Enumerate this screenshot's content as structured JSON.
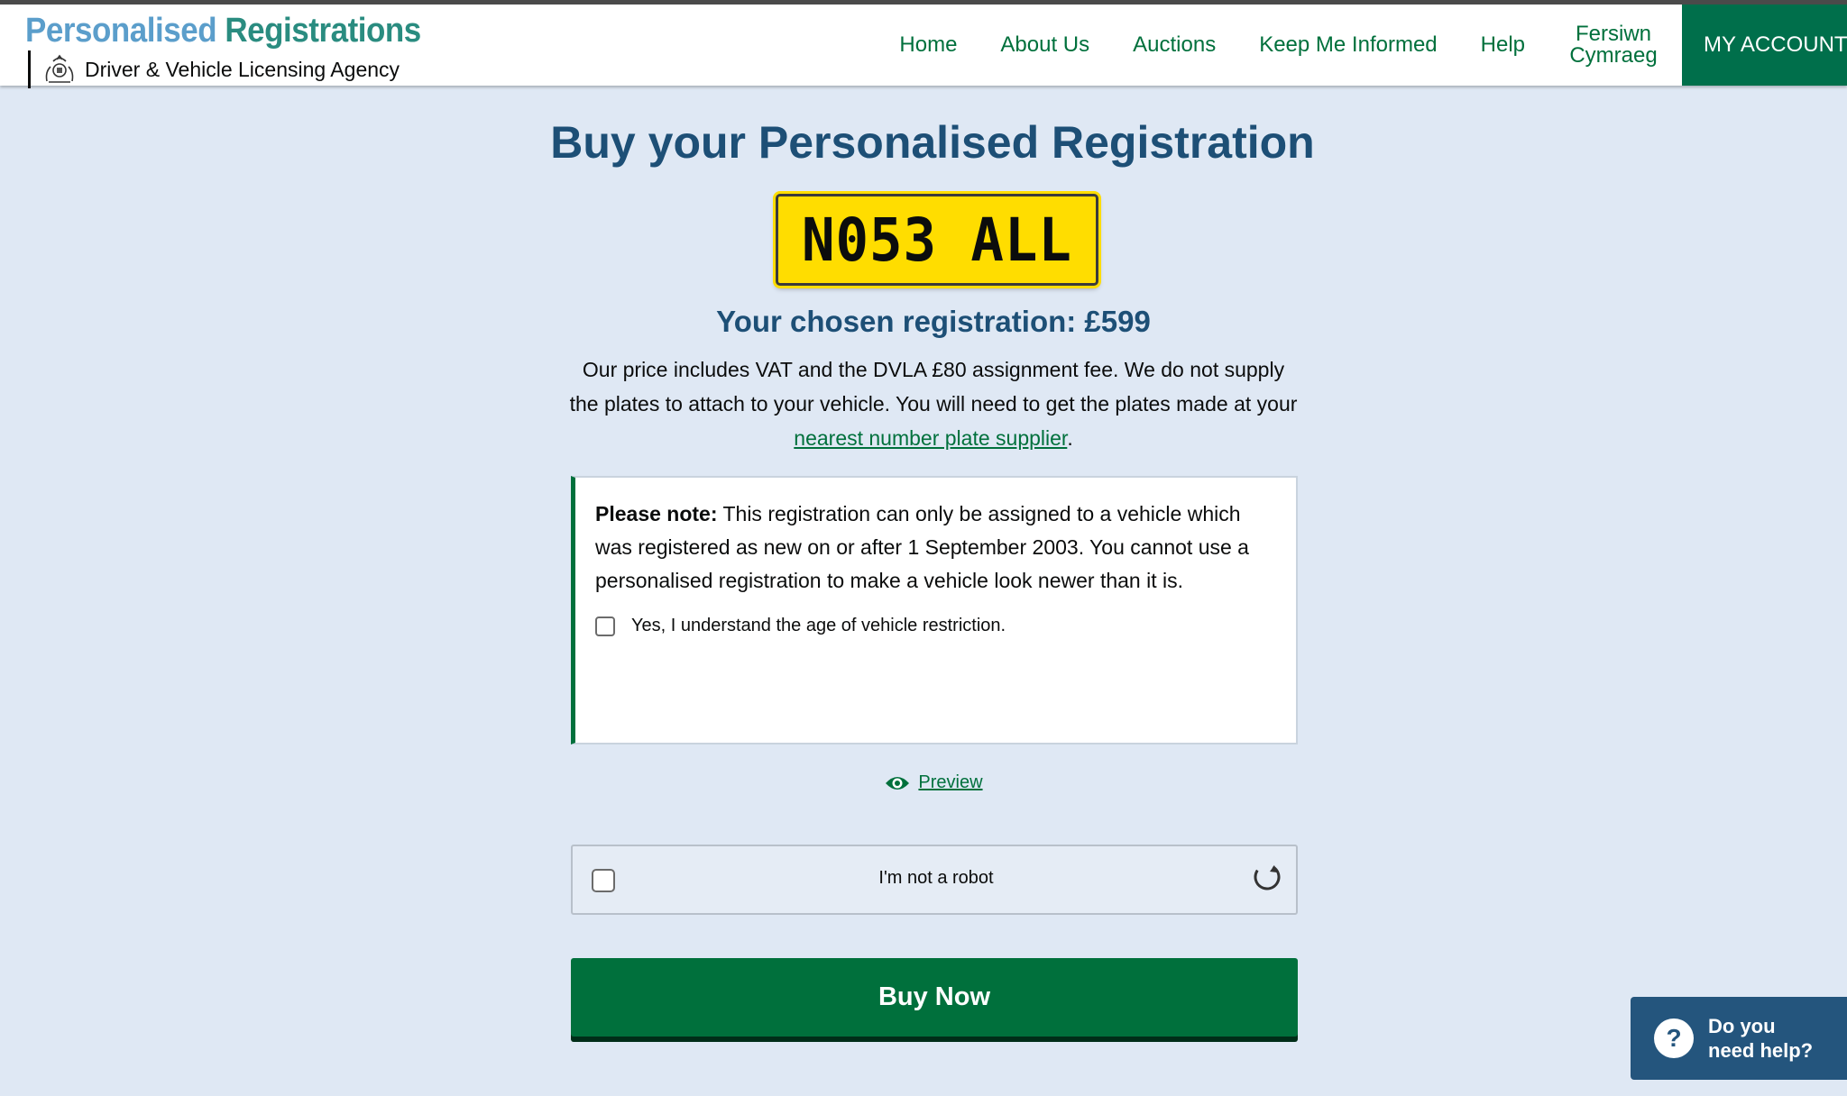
{
  "header": {
    "brand_title_a": "Personalised ",
    "brand_title_b": "Registrations",
    "brand_subtitle": "Driver & Vehicle Licensing Agency",
    "nav": [
      "Home",
      "About Us",
      "Auctions",
      "Keep Me Informed",
      "Help"
    ],
    "lang_line1": "Fersiwn",
    "lang_line2": "Cymraeg",
    "account": "MY ACCOUNT"
  },
  "main": {
    "heading": "Buy your Personalised Registration",
    "plate": "N053 ALL",
    "chosen": "Your chosen registration: £599",
    "price_text_1": "Our price includes VAT and the DVLA £80 assignment fee. We do not supply the plates to attach to your vehicle. You will need to get the plates made at your ",
    "price_link": "nearest number plate supplier",
    "price_text_2": ".",
    "note_label": "Please note:",
    "note_text": " This registration can only be assigned to a vehicle which was registered as new on or after 1 September 2003. You cannot use a personalised registration to make a vehicle look newer than it is.",
    "restriction_checkbox": "Yes, I understand the age of vehicle restriction.",
    "preview": "Preview",
    "captcha": "I'm not a robot",
    "buy_button": "Buy Now"
  },
  "help_widget": {
    "icon": "?",
    "text": "Do you need help?"
  },
  "colors": {
    "brand_green": "#00703c",
    "heading_blue": "#1d4f76",
    "plate_yellow": "#ffdd00",
    "background": "#dfe8f4"
  }
}
